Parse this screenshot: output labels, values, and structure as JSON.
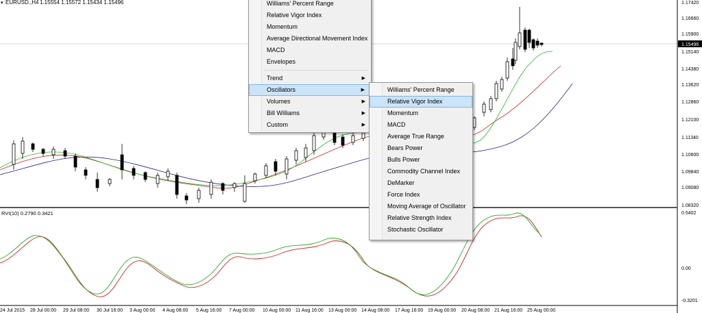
{
  "header": {
    "symbol_label": "EURUSD.,H4",
    "ohlc_label": "1.15554 1.15572 1.15434 1.15496"
  },
  "indicator": {
    "label": "RVI(10) 0.2790 0.3421"
  },
  "price_axis": {
    "ticks": [
      "1.17420",
      "1.16660",
      "1.15900",
      "1.15140",
      "1.14380",
      "1.13620",
      "1.12860",
      "1.12100",
      "1.11340",
      "1.10600",
      "1.09840",
      "1.09080",
      "1.08320"
    ],
    "current_price": "1.15496"
  },
  "indicator_axis": {
    "ticks": [
      "0.5402",
      "0.00",
      "-0.3201"
    ]
  },
  "time_axis": {
    "ticks": [
      "24 Jul 2015",
      "28 Jul 00:00",
      "29 Jul 08:00",
      "30 Jul 16:00",
      "3 Aug 00:00",
      "4 Aug 08:00",
      "5 Aug 16:00",
      "7 Aug 00:00",
      "10 Aug 00:00",
      "11 Aug 16:00",
      "13 Aug 00:00",
      "14 Aug 08:00",
      "17 Aug 16:00",
      "19 Aug 00:00",
      "20 Aug 08:00",
      "21 Aug 16:00",
      "25 Aug 00:00"
    ]
  },
  "colors": {
    "bull_candle": "#ffffff",
    "bear_candle": "#000000",
    "ma_fast": "#22bb22",
    "ma_mid": "#cc2222",
    "ma_slow": "#222288",
    "rvi_main": "#22aa22",
    "rvi_signal": "#cc2222",
    "menu_highlight": "#cce4f7"
  },
  "context_menu": {
    "items": [
      {
        "label": "Williams' Percent Range",
        "submenu": false
      },
      {
        "label": "Relative Vigor Index",
        "submenu": false
      },
      {
        "label": "Momentum",
        "submenu": false
      },
      {
        "label": "Average Directional Movement Index",
        "submenu": false
      },
      {
        "label": "MACD",
        "submenu": false
      },
      {
        "label": "Envelopes",
        "submenu": false
      },
      {
        "label": "Trend",
        "submenu": true
      },
      {
        "label": "Oscillators",
        "submenu": true,
        "selected": true
      },
      {
        "label": "Volumes",
        "submenu": true
      },
      {
        "label": "Bill Williams",
        "submenu": true
      },
      {
        "label": "Custom",
        "submenu": true
      }
    ]
  },
  "oscillators_menu": {
    "items": [
      {
        "label": "Williams' Percent Range"
      },
      {
        "label": "Relative Vigor Index",
        "selected": true
      },
      {
        "label": "Momentum"
      },
      {
        "label": "MACD"
      },
      {
        "label": "Average True Range"
      },
      {
        "label": "Bears Power"
      },
      {
        "label": "Bulls Power"
      },
      {
        "label": "Commodity Channel Index"
      },
      {
        "label": "DeMarker"
      },
      {
        "label": "Force Index"
      },
      {
        "label": "Moving Average of Oscillator"
      },
      {
        "label": "Relative Strength Index"
      },
      {
        "label": "Stochastic Oscillator"
      }
    ]
  }
}
